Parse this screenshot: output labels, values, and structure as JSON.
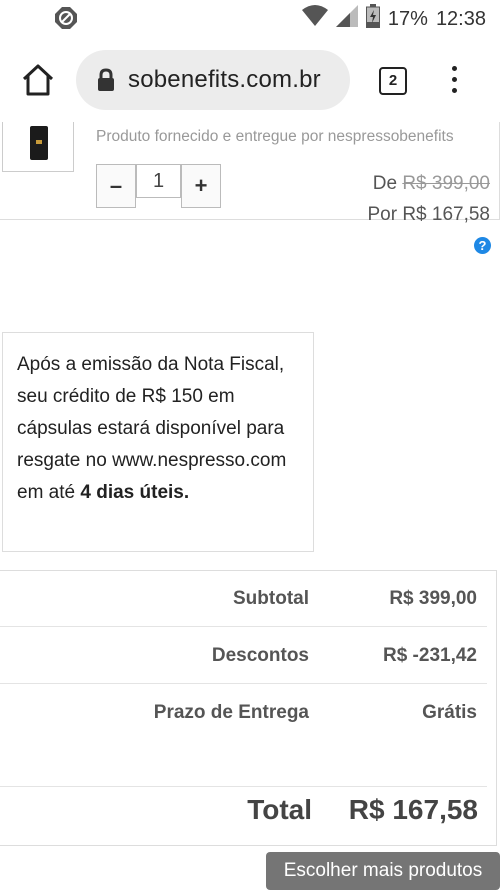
{
  "status_bar": {
    "battery": "17%",
    "time": "12:38"
  },
  "browser": {
    "url": "sobenefits.com.br",
    "tab_count": "2"
  },
  "product": {
    "supplied_by": "Produto fornecido e entregue por nespressobenefits",
    "quantity": "1",
    "minus": "–",
    "plus": "+",
    "price_from_label": "De",
    "price_from": "R$ 399,00",
    "price_now_label": "Por",
    "price_now": "R$ 167,58",
    "help": "?"
  },
  "info": {
    "text": "Após a emissão da Nota Fiscal, seu crédito de R$ 150 em cápsulas estará disponível para resgate no www.nespresso.com em até ",
    "bold": "4 dias úteis."
  },
  "summary": {
    "subtotal_label": "Subtotal",
    "subtotal_value": "R$ 399,00",
    "discounts_label": "Descontos",
    "discounts_value": "R$ -231,42",
    "shipping_label": "Prazo de Entrega",
    "shipping_value": "Grátis",
    "total_label": "Total",
    "total_value": "R$ 167,58"
  },
  "actions": {
    "more_products": "Escolher mais produtos"
  },
  "colors": {
    "help_icon": "#1e88e5",
    "more_button": "#757575"
  }
}
